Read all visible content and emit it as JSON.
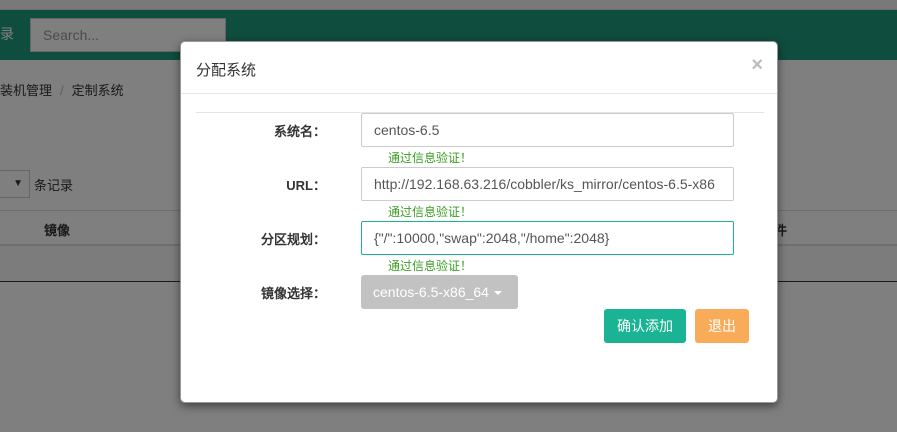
{
  "background": {
    "nav_brand": "录",
    "search_placeholder": "Search...",
    "breadcrumb": [
      "装机管理",
      "定制系统"
    ],
    "records_label": "条记录",
    "table_headers": {
      "image": "镜像",
      "tail": "件"
    }
  },
  "modal": {
    "title": "分配系统",
    "close_symbol": "×",
    "fields": [
      {
        "label": "系统名：",
        "value": "centos-6.5",
        "validation": "通过信息验证！"
      },
      {
        "label": "URL：",
        "value": "http://192.168.63.216/cobbler/ks_mirror/centos-6.5-x86",
        "validation": "通过信息验证！"
      },
      {
        "label": "分区规划：",
        "value": "{\"/\":10000,\"swap\":2048,\"/home\":2048}",
        "validation": "通过信息验证！"
      }
    ],
    "image_select": {
      "label": "镜像选择：",
      "selected": "centos-6.5-x86_64"
    },
    "buttons": {
      "confirm": "确认添加",
      "exit": "退出"
    }
  },
  "colors": {
    "accent": "#1ab394",
    "nav": "#1f9b7d",
    "exit": "#f8ac59",
    "valid": "#3a9d23"
  }
}
